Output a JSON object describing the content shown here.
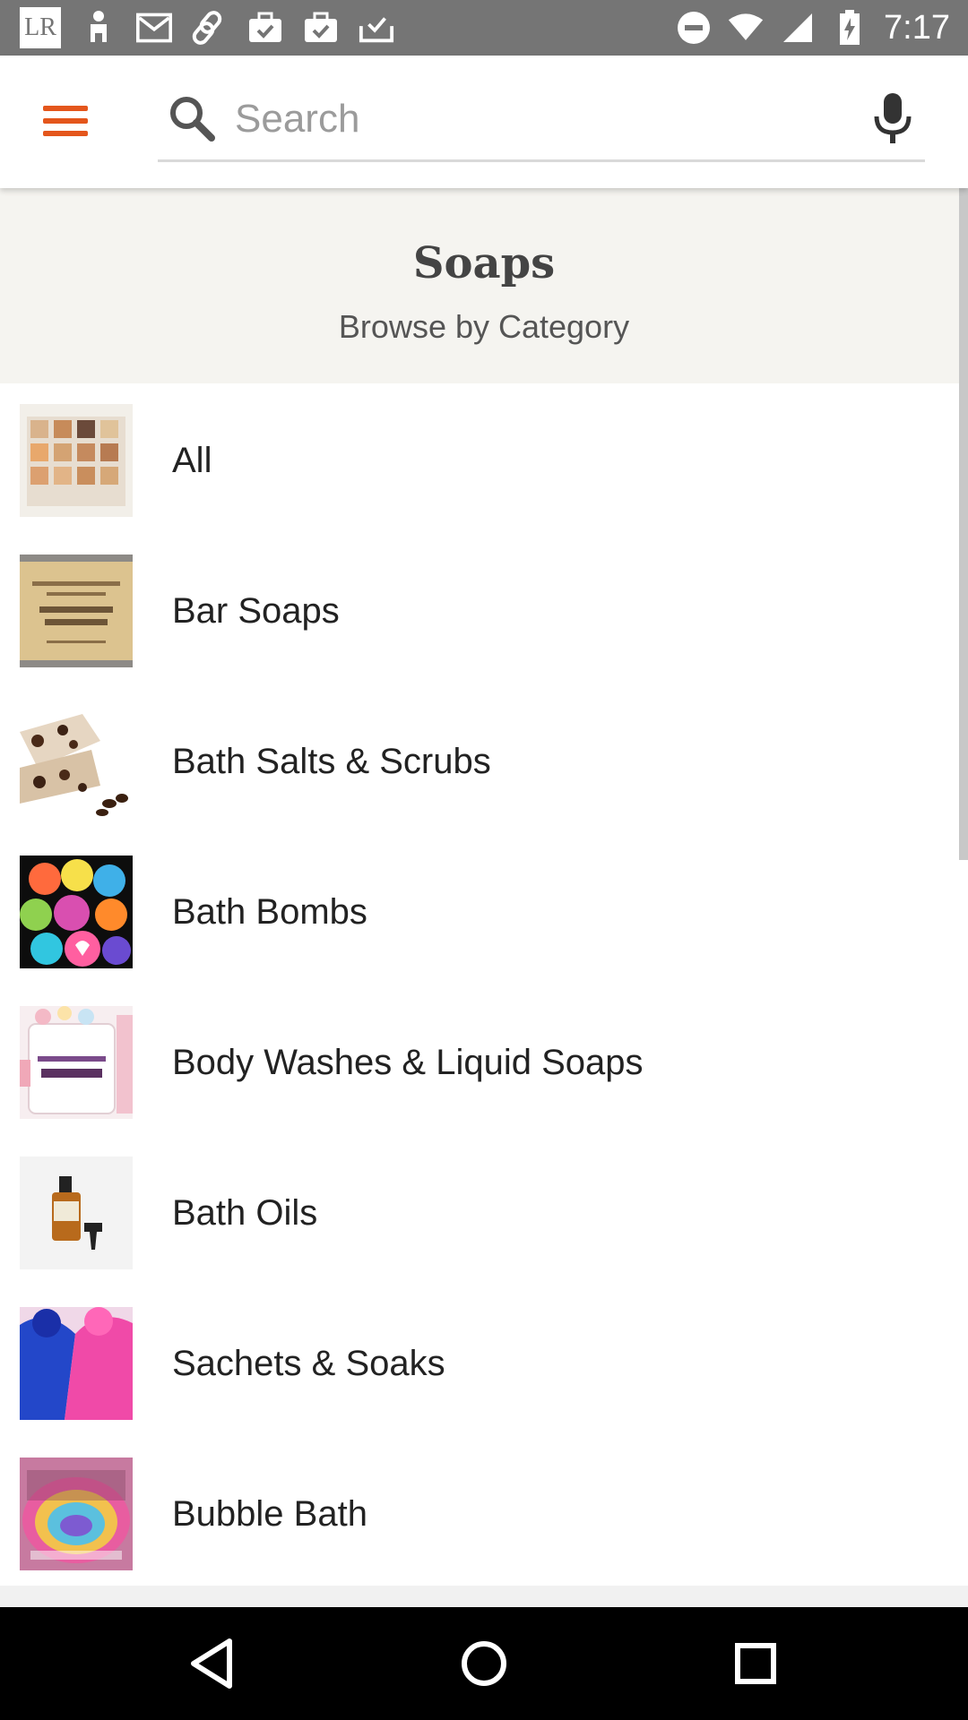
{
  "status_bar": {
    "time": "7:17",
    "badge_text": "LR",
    "left_icons": [
      "lr-badge",
      "person-icon",
      "mail-icon",
      "link-icon",
      "briefcase-check-icon",
      "briefcase-check-icon",
      "inbox-check-icon"
    ],
    "right_icons": [
      "do-not-disturb-icon",
      "wifi-icon",
      "signal-icon",
      "battery-charging-icon"
    ]
  },
  "app_bar": {
    "menu_icon": "hamburger-menu-icon",
    "search_placeholder": "Search",
    "search_value": "",
    "accent_color": "#e4561c"
  },
  "header": {
    "title": "Soaps",
    "subtitle": "Browse by Category"
  },
  "categories": [
    {
      "label": "All",
      "thumb": "assorted-soap-bars"
    },
    {
      "label": "Bar Soaps",
      "thumb": "pumpkin-soap-bar"
    },
    {
      "label": "Bath Salts & Scrubs",
      "thumb": "coffee-scrub-bars"
    },
    {
      "label": "Bath Bombs",
      "thumb": "colorful-bath-bombs"
    },
    {
      "label": "Body Washes & Liquid Soaps",
      "thumb": "whipped-soap-jars"
    },
    {
      "label": "Bath Oils",
      "thumb": "dropper-bottle"
    },
    {
      "label": "Sachets & Soaks",
      "thumb": "blue-pink-salts"
    },
    {
      "label": "Bubble Bath",
      "thumb": "rainbow-bubble-bar"
    }
  ],
  "nav_bar": {
    "icons": [
      "back-icon",
      "home-icon",
      "recents-icon"
    ]
  }
}
